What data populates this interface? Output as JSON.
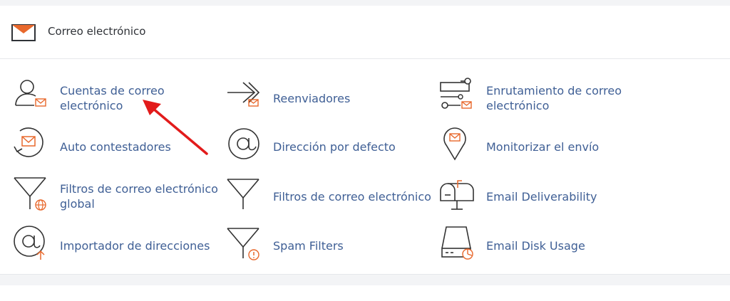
{
  "section": {
    "title": "Correo electrónico",
    "icon": "envelope-icon",
    "accent_color": "#e8682c",
    "link_color": "#3f5f95"
  },
  "items": [
    {
      "label": "Cuentas de correo electrónico",
      "icon": "user-mail-icon"
    },
    {
      "label": "Reenviadores",
      "icon": "forward-icon"
    },
    {
      "label": "Enrutamiento de correo electrónico",
      "icon": "routing-icon"
    },
    {
      "label": "Auto contestadores",
      "icon": "autoresponder-icon"
    },
    {
      "label": "Dirección por defecto",
      "icon": "at-icon"
    },
    {
      "label": "Monitorizar el envío",
      "icon": "location-pin-icon"
    },
    {
      "label": "Filtros de correo electrónico global",
      "icon": "global-filter-icon"
    },
    {
      "label": "Filtros de correo electrónico",
      "icon": "filter-icon"
    },
    {
      "label": "Email Deliverability",
      "icon": "mailbox-icon"
    },
    {
      "label": "Importador de direcciones",
      "icon": "at-import-icon"
    },
    {
      "label": "Spam Filters",
      "icon": "spam-filter-icon"
    },
    {
      "label": "Email Disk Usage",
      "icon": "disk-usage-icon"
    }
  ]
}
